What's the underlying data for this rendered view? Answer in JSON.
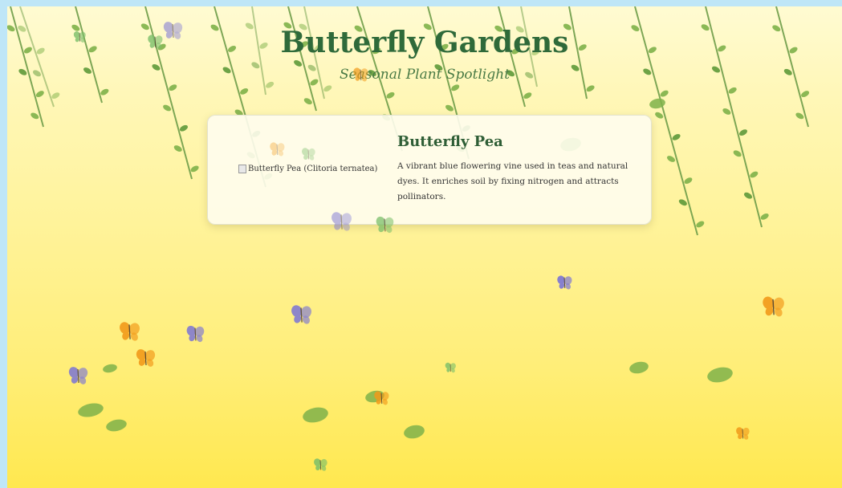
{
  "header": {
    "title": "Butterfly Gardens",
    "subtitle": "Seasonal Plant Spotlight"
  },
  "card": {
    "image_alt": "Butterfly Pea (Clitoria ternatea)",
    "plant_name": "Butterfly Pea",
    "description": "A vibrant blue flowering vine used in teas and natural dyes. It enriches soil by fixing nitrogen and attracts pollinators."
  },
  "colors": {
    "page_border": "#bfe6f7",
    "background_top": "#fffbd2",
    "background_bottom": "#ffe84f",
    "title": "#2f6a3a",
    "vine": "#6f9e4a",
    "leaf": "#7fb24a",
    "butterfly_purple": "#7b74d6",
    "butterfly_orange": "#f29a1a",
    "butterfly_green": "#7bbf6a"
  },
  "icons": [
    "butterfly-icon",
    "leaf-icon",
    "vine-decoration",
    "broken-image-icon"
  ]
}
